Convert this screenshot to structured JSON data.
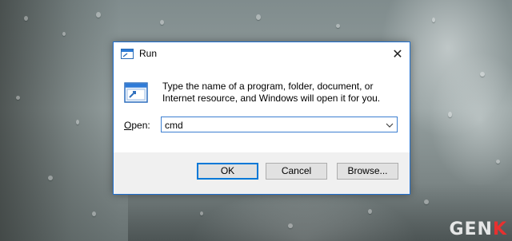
{
  "dialog": {
    "title": "Run",
    "close_glyph": "✕",
    "description": "Type the name of a program, folder, document, or Internet resource, and Windows will open it for you.",
    "open_label_accel": "O",
    "open_label_rest": "pen:",
    "open_value": "cmd",
    "buttons": {
      "ok": "OK",
      "cancel": "Cancel",
      "browse": "Browse..."
    }
  },
  "icons": {
    "title": "run-icon",
    "body": "run-large-icon",
    "combo_arrow": "chevron-down-icon",
    "close": "close-icon"
  },
  "colors": {
    "accent": "#0078d7",
    "dialog_bg": "#ffffff",
    "footer_bg": "#f0f0f0"
  },
  "watermark": {
    "prefix": "GEN",
    "suffix": "K"
  }
}
